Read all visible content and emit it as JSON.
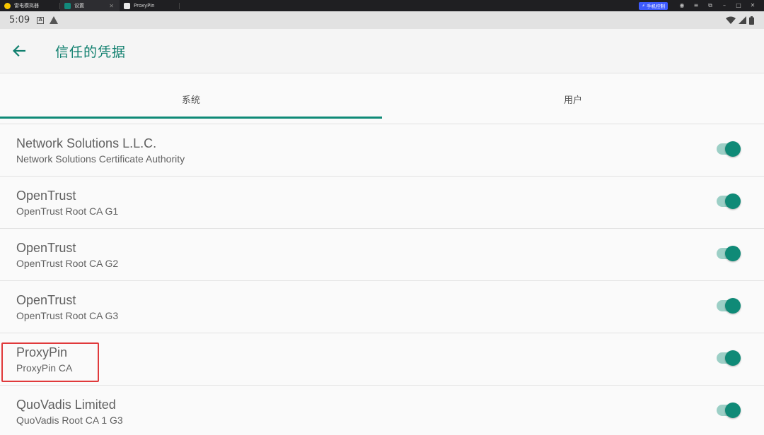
{
  "emulator": {
    "tabs": [
      {
        "label": "雷电模拟器"
      },
      {
        "label": "设置"
      },
      {
        "label": "ProxyPin"
      }
    ],
    "phone_control_label": "手机控制",
    "brand_colors": {
      "accent": "#0f8a77",
      "phone_control": "#3d5afe"
    }
  },
  "status_bar": {
    "time": "5:09",
    "a_icon": "A"
  },
  "app_bar": {
    "title": "信任的凭据"
  },
  "tabs": [
    {
      "label": "系统",
      "active": true
    },
    {
      "label": "用户",
      "active": false
    }
  ],
  "credentials": [
    {
      "title": "Network Solutions L.L.C.",
      "subtitle": "Network Solutions Certificate Authority",
      "enabled": true
    },
    {
      "title": "OpenTrust",
      "subtitle": "OpenTrust Root CA G1",
      "enabled": true
    },
    {
      "title": "OpenTrust",
      "subtitle": "OpenTrust Root CA G2",
      "enabled": true
    },
    {
      "title": "OpenTrust",
      "subtitle": "OpenTrust Root CA G3",
      "enabled": true
    },
    {
      "title": "ProxyPin",
      "subtitle": "ProxyPin CA",
      "enabled": true
    },
    {
      "title": "QuoVadis Limited",
      "subtitle": "QuoVadis Root CA 1 G3",
      "enabled": true
    }
  ]
}
